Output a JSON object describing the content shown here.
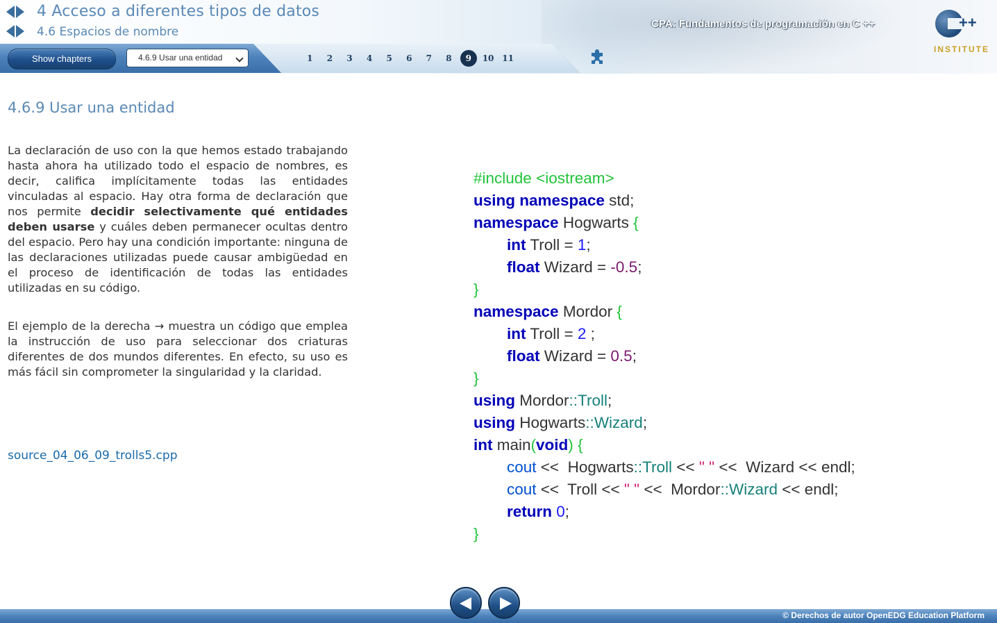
{
  "header": {
    "chapter_title": "4 Acceso a diferentes tipos de datos",
    "section_title": "4.6 Espacios de nombre",
    "course_title": "CPA: Fundamentos de programación en C ++",
    "logo_text": "INSTITUTE",
    "logo_plus": "++"
  },
  "toolbar": {
    "show_chapters_label": "Show chapters",
    "select_value": "4.6.9 Usar una entidad",
    "pages": [
      "1",
      "2",
      "3",
      "4",
      "5",
      "6",
      "7",
      "8",
      "9",
      "10",
      "11"
    ],
    "active_page": "9"
  },
  "content": {
    "title": "4.6.9 Usar una entidad",
    "p1_a": "La declaración de uso con la que hemos estado trabajando hasta ahora ha utilizado todo el espacio de nombres, es decir, califica implícitamente todas las entidades vinculadas al espacio. Hay otra forma de declaración que nos permite ",
    "p1_bold": "decidir selectivamente qué entidades deben usarse",
    "p1_b": " y cuáles deben permanecer ocultas dentro del espacio. Pero hay una condición importante: ninguna de las declaraciones utilizadas puede causar ambigüedad en el proceso de identificación de todas las entidades utilizadas en su código.",
    "p2": "El ejemplo de la derecha → muestra un código que emplea la instrucción de uso para seleccionar dos criaturas diferentes de dos mundos diferentes. En efecto, su uso es más fácil sin comprometer la singularidad y la claridad.",
    "source_link": "source_04_06_09_trolls5.cpp"
  },
  "code": {
    "include": "#include <iostream>",
    "kw_using": "using",
    "kw_namespace": "namespace",
    "kw_int": "int",
    "kw_float": "float",
    "kw_void": "void",
    "kw_return": "return",
    "std": " std;",
    "hogwarts": " Hogwarts ",
    "mordor": " Mordor ",
    "lbrace": "{",
    "rbrace": "}",
    "troll_eq": " Troll = ",
    "wizard_eq": " Wizard = ",
    "one": "1",
    "semi": ";",
    "neg_half": "-0.5",
    "two": "2",
    "sp_semi": " ;",
    "half": "0.5",
    "mordor_sp": " Mordor",
    "hogwarts_sp": " Hogwarts",
    "hogwarts_plain": " Hogwarts",
    "scope": "::",
    "troll": "Troll",
    "wizard": "Wizard",
    "main_sp": " main",
    "lparen": "(",
    "rparen": ")",
    "sp_lbrace": " {",
    "cout": "cout",
    "shl": " << ",
    "space_str": "\" \"",
    "wizard_plain": " Wizard",
    "troll_plain": " Troll",
    "endl_semi": " << endl;",
    "mordor_plain": " Mordor",
    "zero": "0"
  },
  "footer": {
    "copyright": "© Derechos de autor OpenEDG Education Platform"
  },
  "colors": {
    "title_blue": "#5a89b6",
    "keyword": "#0000b8",
    "preprocessor": "#22c33a",
    "member": "#17807a",
    "string": "#d0206f"
  },
  "icons": [
    "left-arrow-icon",
    "right-arrow-icon",
    "puzzle-icon",
    "prev-page-icon",
    "next-page-icon"
  ]
}
